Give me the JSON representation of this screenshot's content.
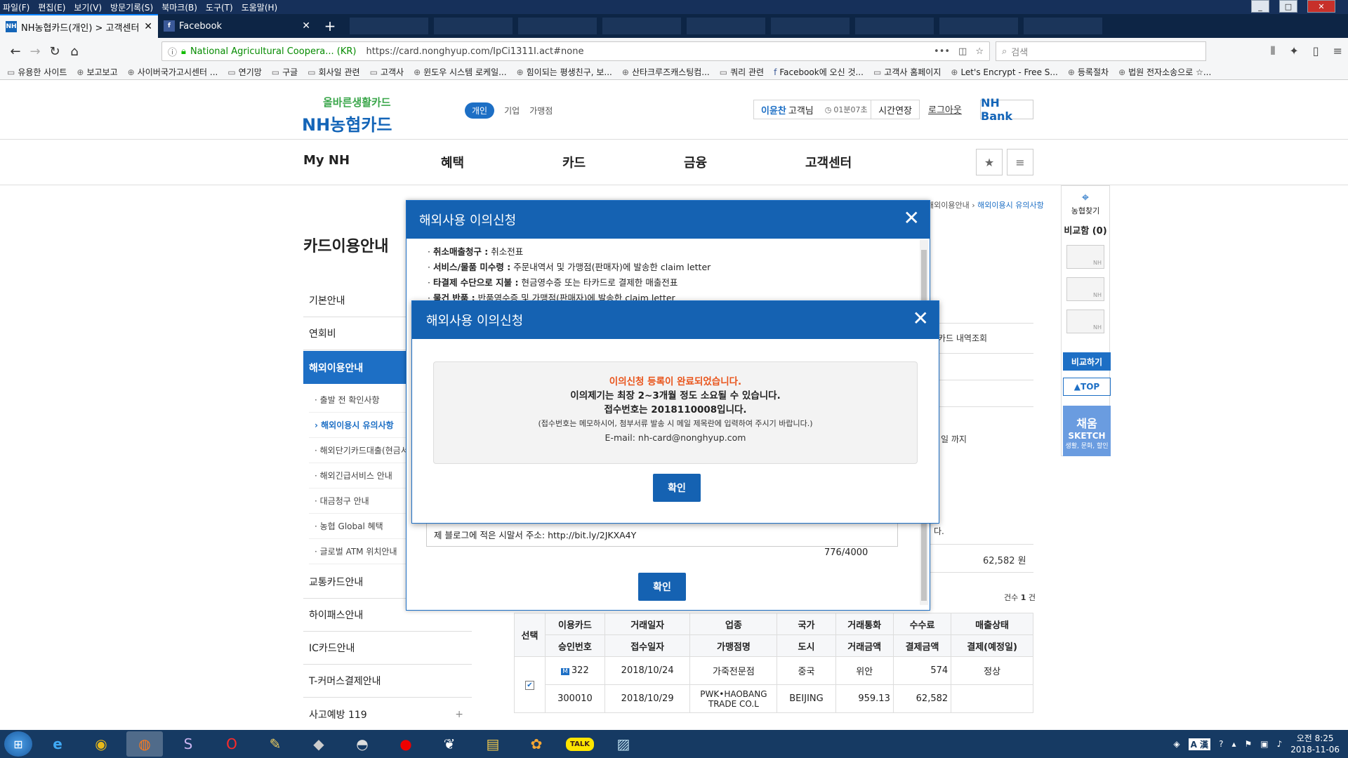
{
  "menubar": {
    "items": [
      "파일(F)",
      "편집(E)",
      "보기(V)",
      "방문기록(S)",
      "북마크(B)",
      "도구(T)",
      "도움말(H)"
    ]
  },
  "window": {
    "min": "_",
    "max": "□",
    "close": "✕"
  },
  "tabs": [
    {
      "label": "NH농협카드(개인) > 고객센터",
      "favicon": "NH"
    },
    {
      "label": "Facebook",
      "favicon": "f"
    }
  ],
  "newtab": "+",
  "nav": {
    "identity": "National Agricultural Coopera... (KR)",
    "url": "https://card.nonghyup.com/IpCi1311I.act#none",
    "search_placeholder": "검색",
    "more": "•••"
  },
  "bookmarks": [
    "유용한 사이트",
    "보고보고",
    "사이버국가고시센터 ...",
    "연기망",
    "구글",
    "회사일 관련",
    "고객사",
    "윈도우 시스템 로케일...",
    "힘이되는 평생친구, 보...",
    "산타크루즈캐스팅컴...",
    "쿼리 관련",
    "Facebook에 오신 것...",
    "고객사 홈페이지",
    "Let's Encrypt - Free S...",
    "등록절차",
    "법원 전자소송으로 ☆..."
  ],
  "site": {
    "logo_top": "올바른생활카드",
    "logo_main": "NH농협카드",
    "segments": [
      "개인",
      "기업",
      "가맹점"
    ],
    "user": {
      "name": "이윤찬",
      "suffix": "고객님",
      "timer": "01분07초",
      "extend": "시간연장"
    },
    "logout": "로그아웃",
    "nhbank": "NH Bank",
    "gnb": [
      "My NH",
      "혜택",
      "카드",
      "금융",
      "고객센터"
    ]
  },
  "sidebar": {
    "title": "카드이용안내",
    "items": [
      "기본안내",
      "연회비",
      "해외이용안내",
      "교통카드안내",
      "하이패스안내",
      "IC카드안내",
      "T-커머스결제안내",
      "사고예방 119"
    ],
    "plus": "+",
    "subitems": [
      "· 출발 전 확인사항",
      "› 해외이용시 유의사항",
      "· 해외단기카드대출(현금서비스)",
      "· 해외긴급서비스 안내",
      "· 대금청구 안내",
      "· 농협 Global 혜택",
      "· 글로벌 ATM 위치안내"
    ]
  },
  "breadcrumb": {
    "prev": "해외이용안내 ›",
    "current": "해외이용시 유의사항"
  },
  "quick": {
    "branch": "농협찾기",
    "compare": "비교함 (0)",
    "card_label": "NH",
    "compare_btn": "비교하기",
    "top": "TOP",
    "sketch_title": "채움",
    "sketch_sub": "SKETCH",
    "sketch_desc": "생활, 문화, 할인"
  },
  "main": {
    "card_history": "카드 내역조회",
    "until": "일 까지",
    "dot": "다.",
    "amount": "62,582 원",
    "count_label": "건수",
    "count": "1",
    "count_unit": "건"
  },
  "table": {
    "select": "선택",
    "h1": [
      "이용카드",
      "거래일자",
      "업종",
      "국가",
      "거래통화",
      "수수료",
      "매출상태"
    ],
    "h2": [
      "승인번호",
      "접수일자",
      "가맹점명",
      "도시",
      "거래금액",
      "결제금액",
      "결제(예정일)"
    ],
    "r1": [
      "322",
      "2018/10/24",
      "가죽전문점",
      "중국",
      "위안",
      "574",
      "정상"
    ],
    "r2": [
      "300010",
      "2018/10/29",
      "PWK•HAOBANG TRADE CO.L",
      "BEIJING",
      "959.13",
      "62,582",
      ""
    ]
  },
  "modal_outer": {
    "title": "해외사용 이의신청",
    "lines": [
      {
        "b": "취소매출청구 :",
        "t": " 취소전표"
      },
      {
        "b": "서비스/물품 미수령 :",
        "t": " 주문내역서 및 가맹점(판매자)에 발송한 claim letter"
      },
      {
        "b": "타결제 수단으로 지불 :",
        "t": " 현금영수증 또는 타카드로 결제한 매출전표"
      },
      {
        "b": "물건 반품 :",
        "t": " 반품영수증 및 가맹점(판매자)에 발송한 claim letter"
      }
    ],
    "memo": "제 블로그에 적은 시말서 주소: http://bit.ly/2JKXA4Y",
    "counter": "776/4000",
    "ok": "확인"
  },
  "modal_inner": {
    "title": "해외사용 이의신청",
    "l1": "이의신청 등록이 완료되었습니다.",
    "l2": "이의제기는 최장 2~3개월 정도 소요될 수 있습니다.",
    "l3": "접수번호는 2018110008입니다.",
    "l4": "(접수번호는 메모하시어, 첨부서류 발송 시 메일 제목란에 입력하여 주시기 바랍니다.)",
    "l5": "E-mail: nh-card@nonghyup.com",
    "ok": "확인"
  },
  "taskbar": {
    "clock_time": "오전 8:25",
    "clock_date": "2018-11-06",
    "ime": "A 漢"
  }
}
